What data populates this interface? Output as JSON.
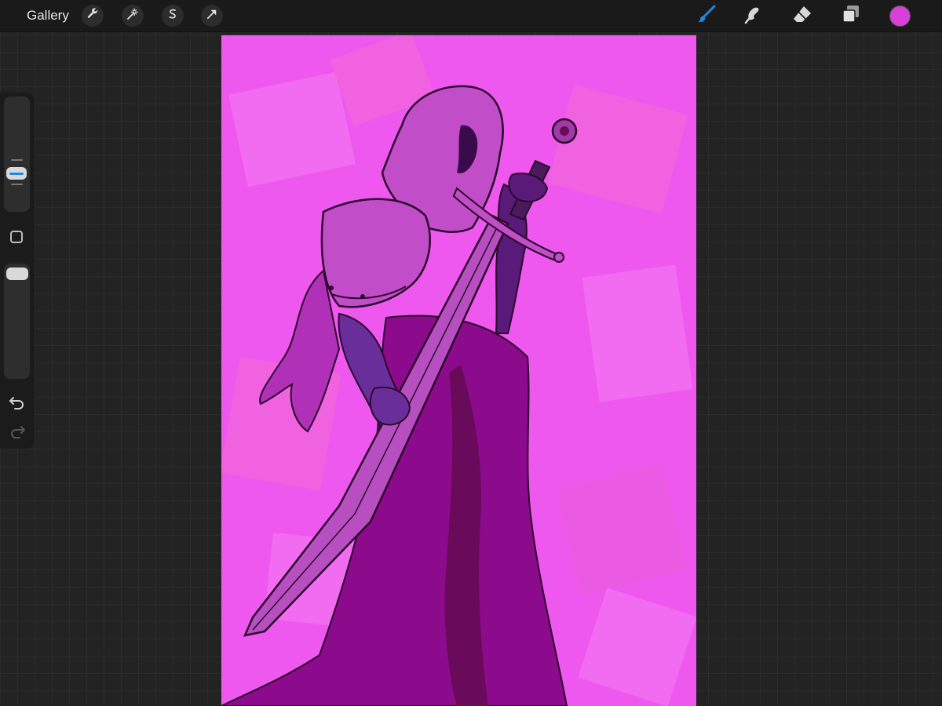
{
  "topbar": {
    "gallery_label": "Gallery",
    "left_tools": [
      {
        "name": "actions",
        "icon": "wrench-icon"
      },
      {
        "name": "adjustments",
        "icon": "magic-wand-icon"
      },
      {
        "name": "selection",
        "icon": "selection-s-icon"
      },
      {
        "name": "transform",
        "icon": "arrow-cursor-icon"
      }
    ],
    "right_tools": [
      {
        "name": "brush",
        "icon": "brush-icon",
        "active": true
      },
      {
        "name": "smudge",
        "icon": "smudge-icon",
        "active": false
      },
      {
        "name": "eraser",
        "icon": "eraser-icon",
        "active": false
      },
      {
        "name": "layers",
        "icon": "layers-icon",
        "active": false
      }
    ],
    "current_color": "#d83fd8"
  },
  "sidebar": {
    "brush_size_slider": {
      "icon": "size-slider-icon"
    },
    "modify_button": {
      "icon": "square-icon"
    },
    "opacity_slider": {
      "icon": "opacity-slider-icon"
    },
    "undo": {
      "icon": "undo-icon"
    },
    "redo": {
      "icon": "redo-icon",
      "enabled": false
    }
  },
  "canvas": {
    "artwork": "knight-with-sword-illustration",
    "palette": {
      "background": "#f05af0",
      "background_light": "#f47cf4",
      "background_pink": "#f26ad6",
      "figure_dark": "#8c0a8c",
      "figure_shadow": "#6a0a5a",
      "armor": "#c24dc8",
      "gauntlet": "#6a2e9a",
      "outline": "#2a0a2a"
    }
  },
  "colors": {
    "accent_blue": "#1e88e5",
    "toolbar_bg": "#1a1a1a",
    "workspace_bg": "#232323"
  }
}
